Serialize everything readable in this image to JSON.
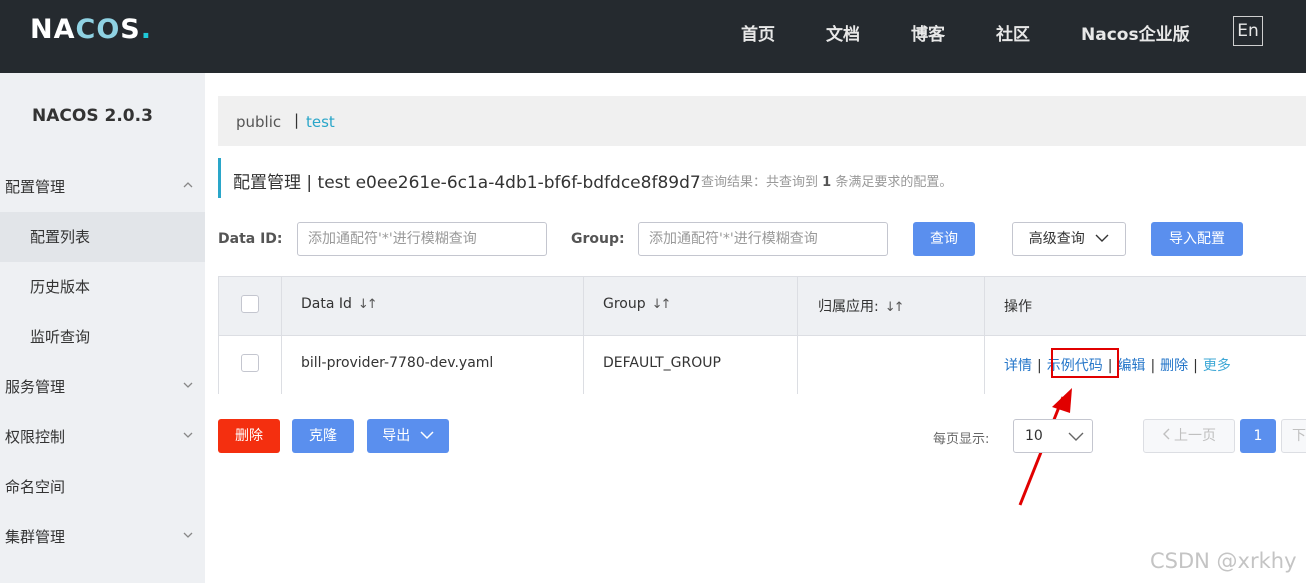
{
  "header": {
    "logo": "NACOS.",
    "nav": [
      "首页",
      "文档",
      "博客",
      "社区",
      "Nacos企业版"
    ],
    "lang": "En"
  },
  "sidebar": {
    "brand": "NACOS 2.0.3",
    "items": [
      {
        "label": "配置管理",
        "type": "group",
        "expanded": true
      },
      {
        "label": "配置列表",
        "type": "sub",
        "active": true
      },
      {
        "label": "历史版本",
        "type": "sub"
      },
      {
        "label": "监听查询",
        "type": "sub"
      },
      {
        "label": "服务管理",
        "type": "group",
        "expanded": false
      },
      {
        "label": "权限控制",
        "type": "group",
        "expanded": false
      },
      {
        "label": "命名空间",
        "type": "group"
      },
      {
        "label": "集群管理",
        "type": "group",
        "expanded": false
      }
    ]
  },
  "breadcrumbs": {
    "namespace1": "public",
    "separator": "|",
    "namespace2": "test"
  },
  "page": {
    "title": "配置管理  |  test  e0ee261e-6c1a-4db1-bf6f-bdfdce8f89d7",
    "result_prefix": "查询结果：共查询到 ",
    "result_count": "1",
    "result_suffix": " 条满足要求的配置。"
  },
  "search": {
    "data_id_label": "Data ID:",
    "data_id_placeholder": "添加通配符'*'进行模糊查询",
    "group_label": "Group:",
    "group_placeholder": "添加通配符'*'进行模糊查询",
    "query_btn": "查询",
    "advanced_btn": "高级查询",
    "import_btn": "导入配置"
  },
  "table": {
    "headers": [
      "Data Id",
      "Group",
      "归属应用:",
      "操作"
    ],
    "rows": [
      {
        "data_id": "bill-provider-7780-dev.yaml",
        "group": "DEFAULT_GROUP",
        "app": ""
      }
    ],
    "ops": [
      "详情",
      "示例代码",
      "编辑",
      "删除",
      "更多"
    ]
  },
  "footer": {
    "delete_btn": "删除",
    "clone_btn": "克隆",
    "export_btn": "导出",
    "page_size_label": "每页显示:",
    "page_size": "10",
    "prev": "上一页",
    "page": "1",
    "next": "下"
  },
  "watermark": "CSDN @xrkhy",
  "colors": {
    "accent": "#2aa6c9",
    "primary": "#5a8fee",
    "danger": "#f42f0f",
    "highlight": "#e10000"
  }
}
